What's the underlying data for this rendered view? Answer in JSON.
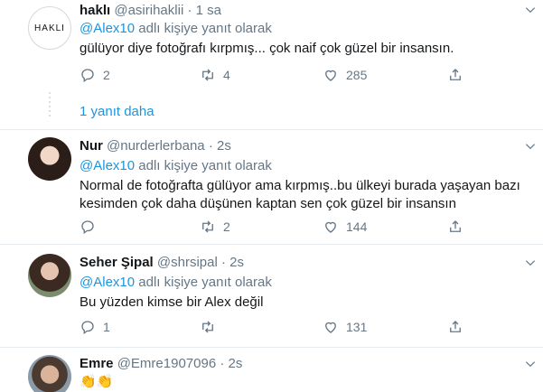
{
  "tweets": [
    {
      "name": "haklı",
      "handle": "@asirihaklii",
      "time": "1 sa",
      "reply_prefix": "@Alex10",
      "reply_suffix": " adlı kişiye yanıt olarak",
      "lines": [
        "gülüyor diye fotoğrafı kırpmış... çok naif çok güzel bir insansın."
      ],
      "replies": "2",
      "retweets": "4",
      "likes": "285",
      "avatar_text": "HAKLI"
    },
    {
      "name": "Nur",
      "handle": "@nurderlerbana",
      "time": "2s",
      "reply_prefix": "@Alex10",
      "reply_suffix": " adlı kişiye yanıt olarak",
      "lines": [
        "Normal de fotoğrafta gülüyor ama kırpmış..bu ülkeyi burada yaşayan bazı",
        "kesimden çok daha düşünen kaptan sen çok güzel bir insansın"
      ],
      "replies": "",
      "retweets": "2",
      "likes": "144"
    },
    {
      "name": "Seher Şipal",
      "handle": "@shrsipal",
      "time": "2s",
      "reply_prefix": "@Alex10",
      "reply_suffix": " adlı kişiye yanıt olarak",
      "lines": [
        "Bu yüzden kimse bir Alex değil"
      ],
      "replies": "1",
      "retweets": "",
      "likes": "131"
    },
    {
      "name": "Emre",
      "handle": "@Emre1907096",
      "time": "2s",
      "lines": [
        "👏👏"
      ]
    }
  ],
  "more_replies_label": "1 yanıt daha",
  "colors": {
    "link": "#1b95e0",
    "muted": "#657786",
    "divider": "#e6ecf0",
    "text": "#14171a"
  },
  "icons": [
    "reply-icon",
    "retweet-icon",
    "like-icon",
    "share-icon",
    "caret-down-icon"
  ]
}
